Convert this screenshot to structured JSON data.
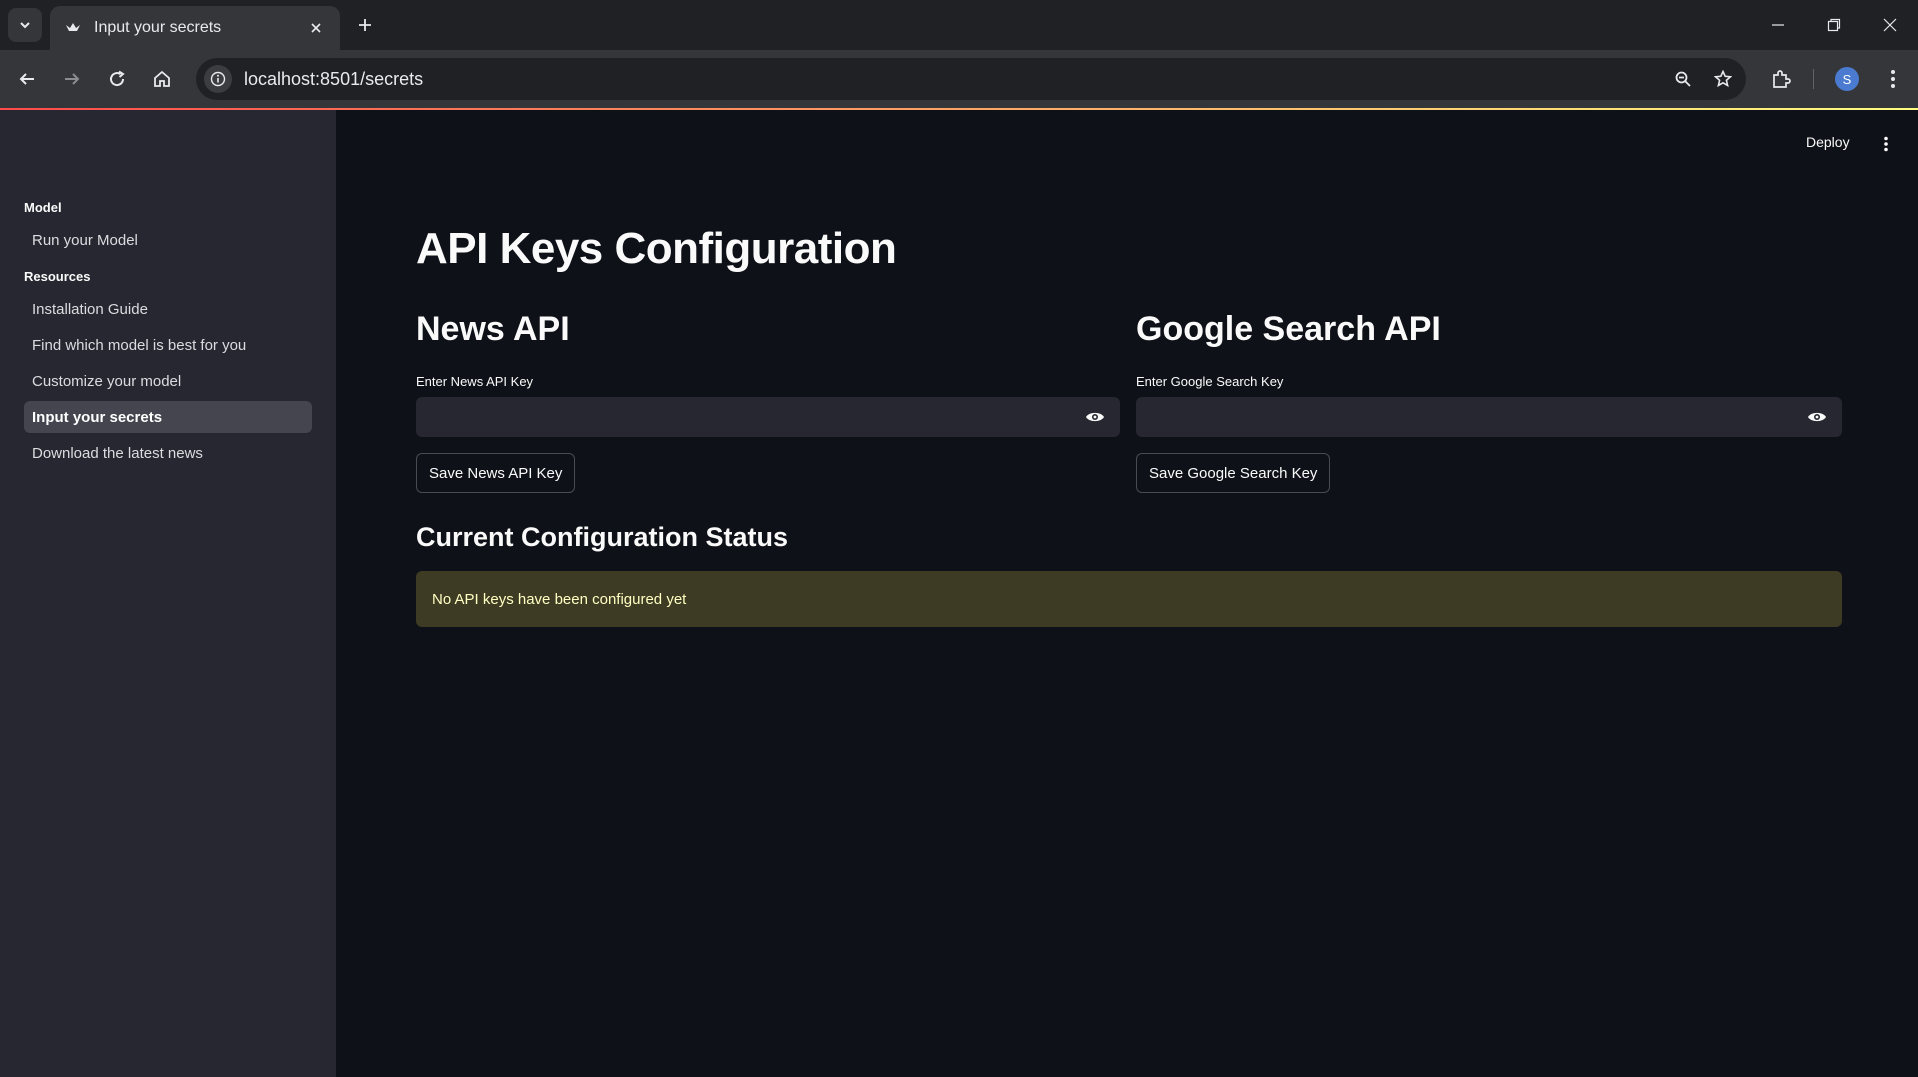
{
  "browser": {
    "tab_title": "Input your secrets",
    "url": "localhost:8501/secrets",
    "profile_initial": "S"
  },
  "app": {
    "deploy_label": "Deploy"
  },
  "sidebar": {
    "sections": [
      {
        "label": "Model",
        "items": [
          {
            "label": "Run your Model",
            "active": false
          }
        ]
      },
      {
        "label": "Resources",
        "items": [
          {
            "label": "Installation Guide",
            "active": false
          },
          {
            "label": "Find which model is best for you",
            "active": false
          },
          {
            "label": "Customize your model",
            "active": false
          },
          {
            "label": "Input your secrets",
            "active": true
          },
          {
            "label": "Download the latest news",
            "active": false
          }
        ]
      }
    ]
  },
  "main": {
    "title": "API Keys Configuration",
    "news": {
      "heading": "News API",
      "field_label": "Enter News API Key",
      "value": "",
      "button": "Save News API Key"
    },
    "google": {
      "heading": "Google Search API",
      "field_label": "Enter Google Search Key",
      "value": "",
      "button": "Save Google Search Key"
    },
    "status": {
      "heading": "Current Configuration Status",
      "message": "No API keys have been configured yet"
    }
  },
  "colors": {
    "app_bg": "#0e1117",
    "sidebar_bg": "#262730",
    "warning_bg": "#3e3b24",
    "warning_text": "#ffffc2"
  }
}
